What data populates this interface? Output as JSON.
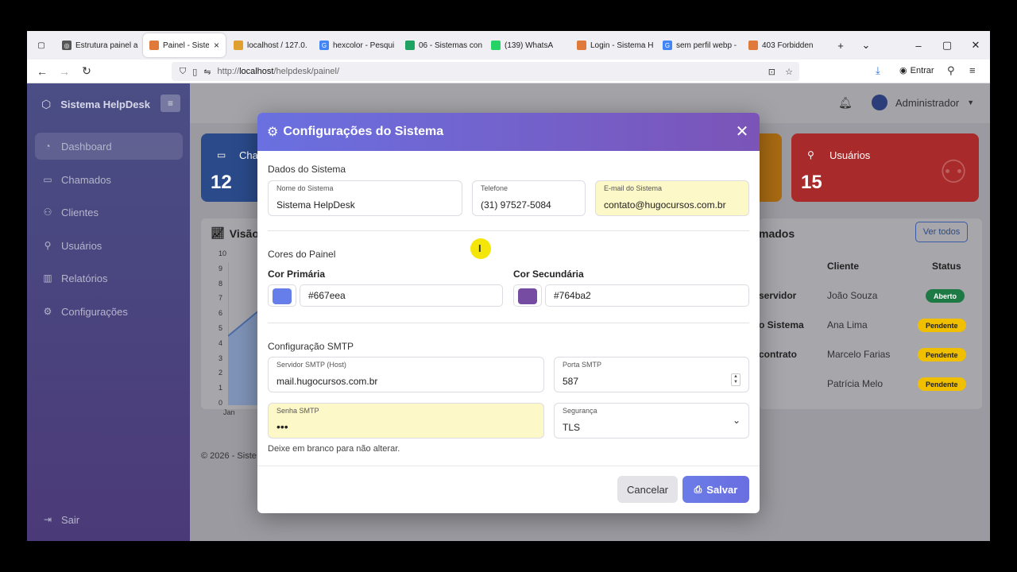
{
  "browser": {
    "tabs": [
      {
        "label": "Estrutura painel a",
        "color": "#555555"
      },
      {
        "label": "Painel - Sistem",
        "color": "#e07a3a",
        "active": true
      },
      {
        "label": "localhost / 127.0.",
        "color": "#e0a030"
      },
      {
        "label": "hexcolor - Pesqui",
        "color": "#4285f4"
      },
      {
        "label": "06 - Sistemas con",
        "color": "#1ea362"
      },
      {
        "label": "(139) WhatsA",
        "color": "#25d366"
      },
      {
        "label": "Login - Sistema H",
        "color": "#e07a3a"
      },
      {
        "label": "sem perfil webp -",
        "color": "#4285f4"
      },
      {
        "label": "403 Forbidden",
        "color": "#e07a3a"
      }
    ],
    "url_prefix": "http://",
    "url_host": "localhost",
    "url_path": "/helpdesk/painel/",
    "login_label": "Entrar"
  },
  "sidebar": {
    "brand": "Sistema HelpDesk",
    "items": [
      {
        "label": "Dashboard",
        "icon": "gauge-icon"
      },
      {
        "label": "Chamados",
        "icon": "ticket-icon"
      },
      {
        "label": "Clientes",
        "icon": "users-icon"
      },
      {
        "label": "Usuários",
        "icon": "user-icon"
      },
      {
        "label": "Relatórios",
        "icon": "bar-chart-icon"
      },
      {
        "label": "Configurações",
        "icon": "gear-icon"
      }
    ],
    "logout": "Sair"
  },
  "header": {
    "user": "Administrador"
  },
  "cards": {
    "chamados": {
      "label": "Cha",
      "value": "12"
    },
    "usuarios": {
      "label": "Usuários",
      "value": "15"
    }
  },
  "chart": {
    "title": "Visão",
    "yticks": [
      "10",
      "9",
      "8",
      "7",
      "6",
      "5",
      "4",
      "3",
      "2",
      "1",
      "0"
    ],
    "xfirst": "Jan"
  },
  "recent": {
    "title": "mados",
    "view_all": "Ver todos",
    "col_client": "Cliente",
    "col_status": "Status",
    "rows": [
      {
        "subject": "servidor",
        "client": "João Souza",
        "status": "Aberto"
      },
      {
        "subject": "o Sistema",
        "client": "Ana Lima",
        "status": "Pendente"
      },
      {
        "subject": "contrato",
        "client": "Marcelo Farias",
        "status": "Pendente"
      },
      {
        "subject": "",
        "client": "Patrícia Melo",
        "status": "Pendente"
      }
    ]
  },
  "footer": "© 2026 - Siste",
  "modal": {
    "title": "Configurações do Sistema",
    "section_system": "Dados do Sistema",
    "name_label": "Nome do Sistema",
    "name_value": "Sistema HelpDesk",
    "phone_label": "Telefone",
    "phone_value": "(31) 97527-5084",
    "email_label": "E-mail do Sistema",
    "email_value": "contato@hugocursos.com.br",
    "section_colors": "Cores do Painel",
    "primary_label": "Cor Primária",
    "primary_value": "#667eea",
    "secondary_label": "Cor Secundária",
    "secondary_value": "#764ba2",
    "section_smtp": "Configuração SMTP",
    "smtp_host_label": "Servidor SMTP (Host)",
    "smtp_host_value": "mail.hugocursos.com.br",
    "smtp_port_label": "Porta SMTP",
    "smtp_port_value": "587",
    "smtp_pass_label": "Senha SMTP",
    "smtp_pass_value": "•••",
    "security_label": "Segurança",
    "security_value": "TLS",
    "help": "Deixe em branco para não alterar.",
    "cancel": "Cancelar",
    "save": "Salvar"
  },
  "colors": {
    "primary": "#667eea",
    "secondary": "#764ba2",
    "badge_open": "#1e7a44",
    "badge_pending": "#f0c000"
  }
}
